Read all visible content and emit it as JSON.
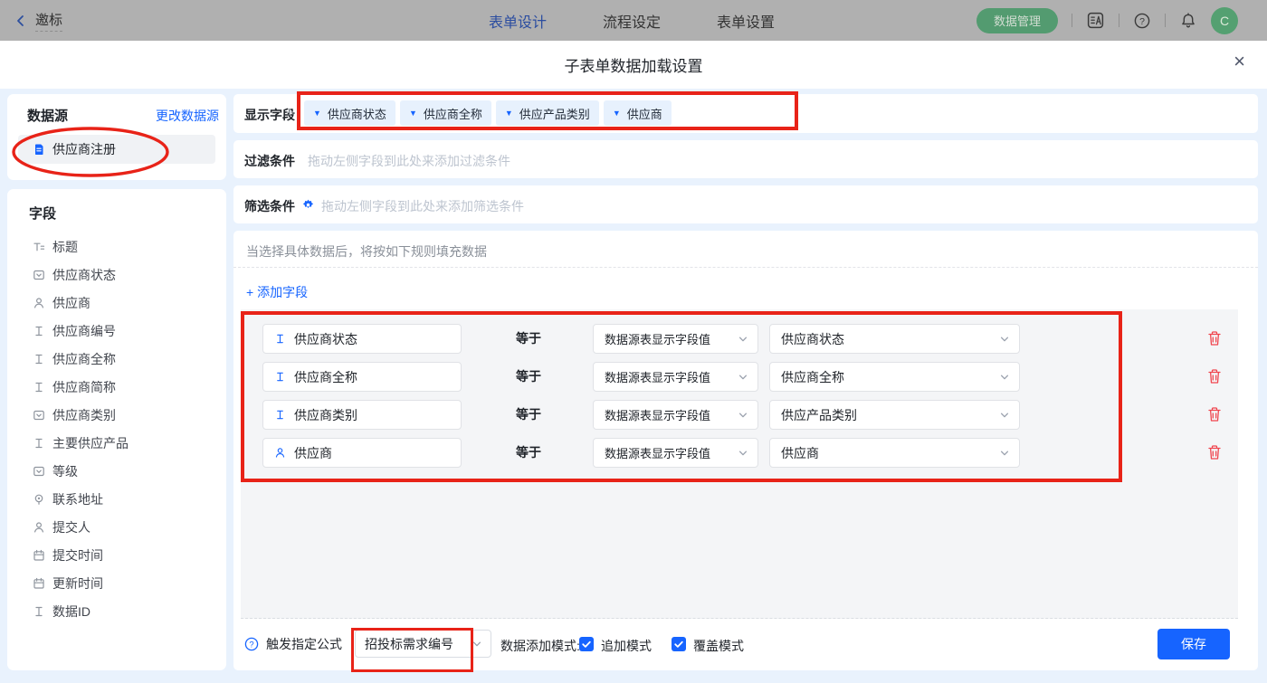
{
  "topbar": {
    "back_label": "邀标",
    "tabs": [
      {
        "label": "表单设计",
        "active": true
      },
      {
        "label": "流程设定",
        "active": false
      },
      {
        "label": "表单设置",
        "active": false
      }
    ],
    "data_manage_button": "数据管理",
    "avatar_initial": "C"
  },
  "modal": {
    "title": "子表单数据加载设置"
  },
  "datasource": {
    "title": "数据源",
    "change_link": "更改数据源",
    "selected": "供应商注册"
  },
  "fields_panel": {
    "title": "字段",
    "items": [
      {
        "label": "标题",
        "icon": "title-icon"
      },
      {
        "label": "供应商状态",
        "icon": "select-icon"
      },
      {
        "label": "供应商",
        "icon": "person-icon"
      },
      {
        "label": "供应商编号",
        "icon": "text-icon"
      },
      {
        "label": "供应商全称",
        "icon": "text-icon"
      },
      {
        "label": "供应商简称",
        "icon": "text-icon"
      },
      {
        "label": "供应商类别",
        "icon": "select-icon"
      },
      {
        "label": "主要供应产品",
        "icon": "text-icon"
      },
      {
        "label": "等级",
        "icon": "select-icon"
      },
      {
        "label": "联系地址",
        "icon": "location-icon"
      },
      {
        "label": "提交人",
        "icon": "person-icon"
      },
      {
        "label": "提交时间",
        "icon": "calendar-icon"
      },
      {
        "label": "更新时间",
        "icon": "calendar-icon"
      },
      {
        "label": "数据ID",
        "icon": "text-icon"
      }
    ]
  },
  "display_fields": {
    "label": "显示字段",
    "chips": [
      "供应商状态",
      "供应商全称",
      "供应产品类别",
      "供应商"
    ]
  },
  "filter": {
    "label": "过滤条件",
    "placeholder": "拖动左侧字段到此处来添加过滤条件"
  },
  "sift": {
    "label": "筛选条件",
    "placeholder": "拖动左侧字段到此处来添加筛选条件"
  },
  "rules": {
    "header": "当选择具体数据后，将按如下规则填充数据",
    "add_field_label": "添加字段",
    "equals_label": "等于",
    "rows": [
      {
        "field": "供应商状态",
        "icon": "text-icon",
        "source": "数据源表显示字段值",
        "value": "供应商状态"
      },
      {
        "field": "供应商全称",
        "icon": "text-icon",
        "source": "数据源表显示字段值",
        "value": "供应商全称"
      },
      {
        "field": "供应商类别",
        "icon": "text-icon",
        "source": "数据源表显示字段值",
        "value": "供应产品类别"
      },
      {
        "field": "供应商",
        "icon": "person-icon",
        "source": "数据源表显示字段值",
        "value": "供应商"
      }
    ]
  },
  "footer": {
    "formula_label": "触发指定公式",
    "formula_value": "招投标需求编号",
    "mode_label": "数据添加模式:",
    "modes": [
      {
        "label": "追加模式",
        "checked": true
      },
      {
        "label": "覆盖模式",
        "checked": true
      }
    ],
    "save_label": "保存"
  },
  "icons": [
    "back-icon",
    "translate-icon",
    "help-icon",
    "bell-icon",
    "close-icon",
    "document-icon",
    "gear-icon",
    "title-icon",
    "select-icon",
    "person-icon",
    "text-icon",
    "calendar-icon",
    "location-icon",
    "trash-icon",
    "chevron-down-icon",
    "dropdown-caret-icon",
    "question-icon",
    "plus-icon",
    "checkmark-icon"
  ],
  "colors": {
    "accent": "#1664ff",
    "annotation_red": "#e82318",
    "body_bg": "#e9f2fd",
    "panel_gray": "#f4f5f7",
    "green_badge": "#539b70"
  },
  "annotations": {
    "color": "#e82318",
    "shapes": [
      "ellipse-around-datasource-item",
      "rect-around-display-field-chips",
      "rect-around-mapping-rows",
      "rect-around-formula-select"
    ]
  }
}
